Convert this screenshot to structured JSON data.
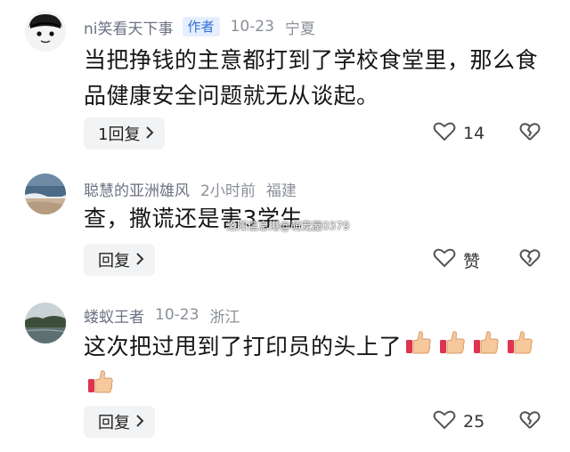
{
  "comments": [
    {
      "nickname": "ni笑看天下事",
      "badge": "作者",
      "time": "10-23",
      "location": "宁夏",
      "text": "当把挣钱的主意都打到了学校食堂里，那么食品健康安全问题就无从谈起。",
      "reply_label": "1回复",
      "like_count": "14",
      "avatar": "cartoon-face-avatar"
    },
    {
      "nickname": "聪慧的亚洲雄风",
      "time": "2小时前",
      "location": "福建",
      "text": "查，撒谎还是害3学生",
      "reply_label": "回复",
      "like_label": "赞",
      "avatar": "beach-photo-avatar"
    },
    {
      "nickname": "蝼蚁王者",
      "time": "10-23",
      "location": "浙江",
      "text": "这次把过甩到了打印员的头上了",
      "emoji_count": 5,
      "emoji": "thumbs-up-emoji",
      "reply_label": "回复",
      "like_count": "25",
      "avatar": "landscape-photo-avatar"
    }
  ],
  "watermark": "洛阳信息港@萌宠屋0379",
  "colors": {
    "badge_text": "#2f6fd6",
    "badge_bg": "#e6efff",
    "meta_gray": "#8a8f99",
    "button_bg": "#f2f3f5"
  },
  "icons": {
    "like": "heart-outline-icon",
    "dislike": "broken-heart-icon",
    "chevron": "chevron-right-icon"
  }
}
